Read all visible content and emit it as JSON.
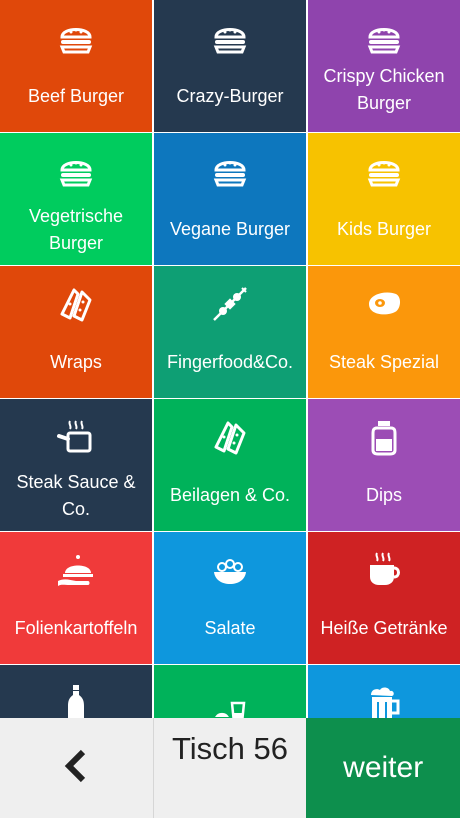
{
  "tiles": [
    {
      "label": "Beef Burger",
      "color": "#e0480a",
      "icon": "burger-icon"
    },
    {
      "label": "Crazy-Burger",
      "color": "#25394f",
      "icon": "burger-icon"
    },
    {
      "label": "Crispy Chicken Burger",
      "color": "#8f44ad",
      "icon": "burger-icon"
    },
    {
      "label": "Vegetrische Burger",
      "color": "#00cc5e",
      "icon": "burger-icon"
    },
    {
      "label": "Vegane Burger",
      "color": "#0d77be",
      "icon": "burger-icon"
    },
    {
      "label": "Kids Burger",
      "color": "#f7c200",
      "icon": "burger-icon"
    },
    {
      "label": "Wraps",
      "color": "#e0480a",
      "icon": "tortilla-icon"
    },
    {
      "label": "Fingerfood&Co.",
      "color": "#0e9f74",
      "icon": "skewer-icon"
    },
    {
      "label": "Steak Spezial",
      "color": "#fb970b",
      "icon": "steak-icon"
    },
    {
      "label": "Steak Sauce & Co.",
      "color": "#25394f",
      "icon": "saucepan-icon"
    },
    {
      "label": "Beilagen & Co.",
      "color": "#00b25a",
      "icon": "tortilla-icon"
    },
    {
      "label": "Dips",
      "color": "#9c4db5",
      "icon": "jar-icon"
    },
    {
      "label": "Folienkartoffeln",
      "color": "#f03a3a",
      "icon": "cloche-icon"
    },
    {
      "label": "Salate",
      "color": "#0e97dd",
      "icon": "salad-icon"
    },
    {
      "label": "Heiße Getränke",
      "color": "#cf2223",
      "icon": "hot-cup-icon"
    },
    {
      "label": "",
      "color": "#25394f",
      "icon": "bottle-icon"
    },
    {
      "label": "",
      "color": "#00b25a",
      "icon": "lemon-drink-icon"
    },
    {
      "label": "",
      "color": "#0e97dd",
      "icon": "beer-mug-icon"
    }
  ],
  "footer": {
    "back_icon": "chevron-left-icon",
    "table_label": "Tisch 56",
    "next_label": "weiter"
  }
}
